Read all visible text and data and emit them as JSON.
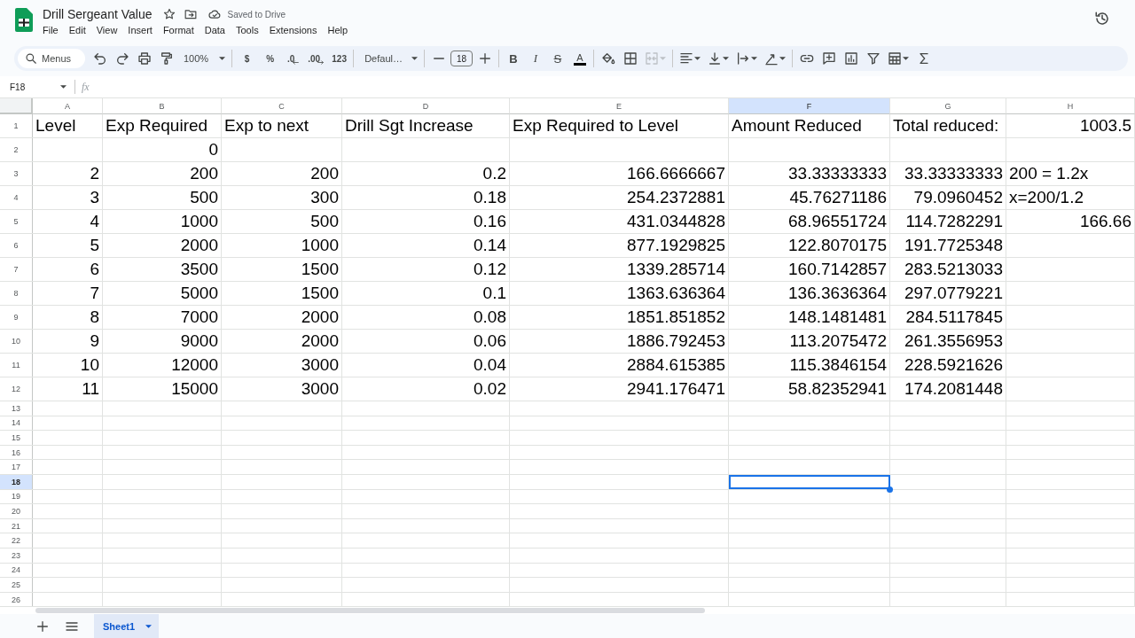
{
  "window": {
    "title": "Drill Sergeant Value",
    "status": "Saved to Drive"
  },
  "menu": [
    "File",
    "Edit",
    "View",
    "Insert",
    "Format",
    "Data",
    "Tools",
    "Extensions",
    "Help"
  ],
  "toolbar": {
    "search": {
      "placeholder": "Menus"
    },
    "zoom": "100%",
    "number_formats": [
      {
        "label": "$",
        "kind": "currency"
      },
      {
        "label": "%",
        "kind": "percent"
      },
      {
        "label": ".0",
        "kind": "decrease_decimal"
      },
      {
        "label": ".00",
        "kind": "increase_decimal"
      },
      {
        "label": "123",
        "kind": "format"
      }
    ],
    "font": "Defaul…",
    "font_size": "18",
    "text_styles": [
      {
        "label": "B",
        "kind": "bold"
      },
      {
        "label": "I",
        "kind": "italic"
      },
      {
        "label": "S",
        "kind": "strikethrough"
      },
      {
        "label": "A",
        "kind": "text_color"
      }
    ],
    "merge_cells": {
      "disabled": true
    }
  },
  "formula_bar": {
    "name_box": "F18",
    "fx_label": "fx"
  },
  "grid": {
    "columns": [
      {
        "label": "A",
        "selected": false
      },
      {
        "label": "B",
        "selected": false
      },
      {
        "label": "C",
        "selected": false
      },
      {
        "label": "D",
        "selected": false
      },
      {
        "label": "E",
        "selected": false
      },
      {
        "label": "F",
        "selected": true
      },
      {
        "label": "G",
        "selected": false
      },
      {
        "label": "H",
        "selected": false
      }
    ],
    "rows": [
      {
        "number": "1",
        "selected": false,
        "cells": [
          {
            "value": "Level",
            "kind": "text"
          },
          {
            "value": "Exp Required",
            "kind": "text"
          },
          {
            "value": "Exp to next",
            "kind": "text"
          },
          {
            "value": "Drill Sgt Increase",
            "kind": "text"
          },
          {
            "value": "Exp Required to Level",
            "kind": "text"
          },
          {
            "value": "Amount Reduced",
            "kind": "text"
          },
          {
            "value": "Total reduced:",
            "kind": "text"
          },
          {
            "value": "1003.5",
            "kind": "number"
          }
        ]
      },
      {
        "number": "2",
        "selected": false,
        "cells": [
          null,
          {
            "value": "0",
            "kind": "number"
          }
        ]
      },
      {
        "number": "3",
        "selected": false,
        "cells": [
          {
            "value": "2",
            "kind": "number"
          },
          {
            "value": "200",
            "kind": "number"
          },
          {
            "value": "200",
            "kind": "number"
          },
          {
            "value": "0.2",
            "kind": "number"
          },
          {
            "value": "166.6666667",
            "kind": "number"
          },
          {
            "value": "33.33333333",
            "kind": "number"
          },
          {
            "value": "33.33333333",
            "kind": "number"
          },
          {
            "value": "200 = 1.2x",
            "kind": "text"
          }
        ]
      },
      {
        "number": "4",
        "selected": false,
        "cells": [
          {
            "value": "3",
            "kind": "number"
          },
          {
            "value": "500",
            "kind": "number"
          },
          {
            "value": "300",
            "kind": "number"
          },
          {
            "value": "0.18",
            "kind": "number"
          },
          {
            "value": "254.2372881",
            "kind": "number"
          },
          {
            "value": "45.76271186",
            "kind": "number"
          },
          {
            "value": "79.0960452",
            "kind": "number"
          },
          {
            "value": "x=200/1.2",
            "kind": "text"
          }
        ]
      },
      {
        "number": "5",
        "selected": false,
        "cells": [
          {
            "value": "4",
            "kind": "number"
          },
          {
            "value": "1000",
            "kind": "number"
          },
          {
            "value": "500",
            "kind": "number"
          },
          {
            "value": "0.16",
            "kind": "number"
          },
          {
            "value": "431.0344828",
            "kind": "number"
          },
          {
            "value": "68.96551724",
            "kind": "number"
          },
          {
            "value": "114.7282291",
            "kind": "number"
          },
          {
            "value": "166.66",
            "kind": "number"
          }
        ]
      },
      {
        "number": "6",
        "selected": false,
        "cells": [
          {
            "value": "5",
            "kind": "number"
          },
          {
            "value": "2000",
            "kind": "number"
          },
          {
            "value": "1000",
            "kind": "number"
          },
          {
            "value": "0.14",
            "kind": "number"
          },
          {
            "value": "877.1929825",
            "kind": "number"
          },
          {
            "value": "122.8070175",
            "kind": "number"
          },
          {
            "value": "191.7725348",
            "kind": "number"
          }
        ]
      },
      {
        "number": "7",
        "selected": false,
        "cells": [
          {
            "value": "6",
            "kind": "number"
          },
          {
            "value": "3500",
            "kind": "number"
          },
          {
            "value": "1500",
            "kind": "number"
          },
          {
            "value": "0.12",
            "kind": "number"
          },
          {
            "value": "1339.285714",
            "kind": "number"
          },
          {
            "value": "160.7142857",
            "kind": "number"
          },
          {
            "value": "283.5213033",
            "kind": "number"
          }
        ]
      },
      {
        "number": "8",
        "selected": false,
        "cells": [
          {
            "value": "7",
            "kind": "number"
          },
          {
            "value": "5000",
            "kind": "number"
          },
          {
            "value": "1500",
            "kind": "number"
          },
          {
            "value": "0.1",
            "kind": "number"
          },
          {
            "value": "1363.636364",
            "kind": "number"
          },
          {
            "value": "136.3636364",
            "kind": "number"
          },
          {
            "value": "297.0779221",
            "kind": "number"
          }
        ]
      },
      {
        "number": "9",
        "selected": false,
        "cells": [
          {
            "value": "8",
            "kind": "number"
          },
          {
            "value": "7000",
            "kind": "number"
          },
          {
            "value": "2000",
            "kind": "number"
          },
          {
            "value": "0.08",
            "kind": "number"
          },
          {
            "value": "1851.851852",
            "kind": "number"
          },
          {
            "value": "148.1481481",
            "kind": "number"
          },
          {
            "value": "284.5117845",
            "kind": "number"
          }
        ]
      },
      {
        "number": "10",
        "selected": false,
        "cells": [
          {
            "value": "9",
            "kind": "number"
          },
          {
            "value": "9000",
            "kind": "number"
          },
          {
            "value": "2000",
            "kind": "number"
          },
          {
            "value": "0.06",
            "kind": "number"
          },
          {
            "value": "1886.792453",
            "kind": "number"
          },
          {
            "value": "113.2075472",
            "kind": "number"
          },
          {
            "value": "261.3556953",
            "kind": "number"
          }
        ]
      },
      {
        "number": "11",
        "selected": false,
        "cells": [
          {
            "value": "10",
            "kind": "number"
          },
          {
            "value": "12000",
            "kind": "number"
          },
          {
            "value": "3000",
            "kind": "number"
          },
          {
            "value": "0.04",
            "kind": "number"
          },
          {
            "value": "2884.615385",
            "kind": "number"
          },
          {
            "value": "115.3846154",
            "kind": "number"
          },
          {
            "value": "228.5921626",
            "kind": "number"
          }
        ]
      },
      {
        "number": "12",
        "selected": false,
        "cells": [
          {
            "value": "11",
            "kind": "number"
          },
          {
            "value": "15000",
            "kind": "number"
          },
          {
            "value": "3000",
            "kind": "number"
          },
          {
            "value": "0.02",
            "kind": "number"
          },
          {
            "value": "2941.176471",
            "kind": "number"
          },
          {
            "value": "58.82352941",
            "kind": "number"
          },
          {
            "value": "174.2081448",
            "kind": "number"
          }
        ]
      },
      {
        "number": "13",
        "selected": false
      },
      {
        "number": "14",
        "selected": false
      },
      {
        "number": "15",
        "selected": false
      },
      {
        "number": "16",
        "selected": false
      },
      {
        "number": "17",
        "selected": false
      },
      {
        "number": "18",
        "selected": true
      },
      {
        "number": "19",
        "selected": false
      },
      {
        "number": "20",
        "selected": false
      },
      {
        "number": "21",
        "selected": false
      },
      {
        "number": "22",
        "selected": false
      },
      {
        "number": "23",
        "selected": false
      },
      {
        "number": "24",
        "selected": false
      },
      {
        "number": "25",
        "selected": false
      },
      {
        "number": "26",
        "selected": false
      }
    ]
  },
  "sheet_tabs": [
    {
      "label": "Sheet1",
      "selected": true
    }
  ]
}
